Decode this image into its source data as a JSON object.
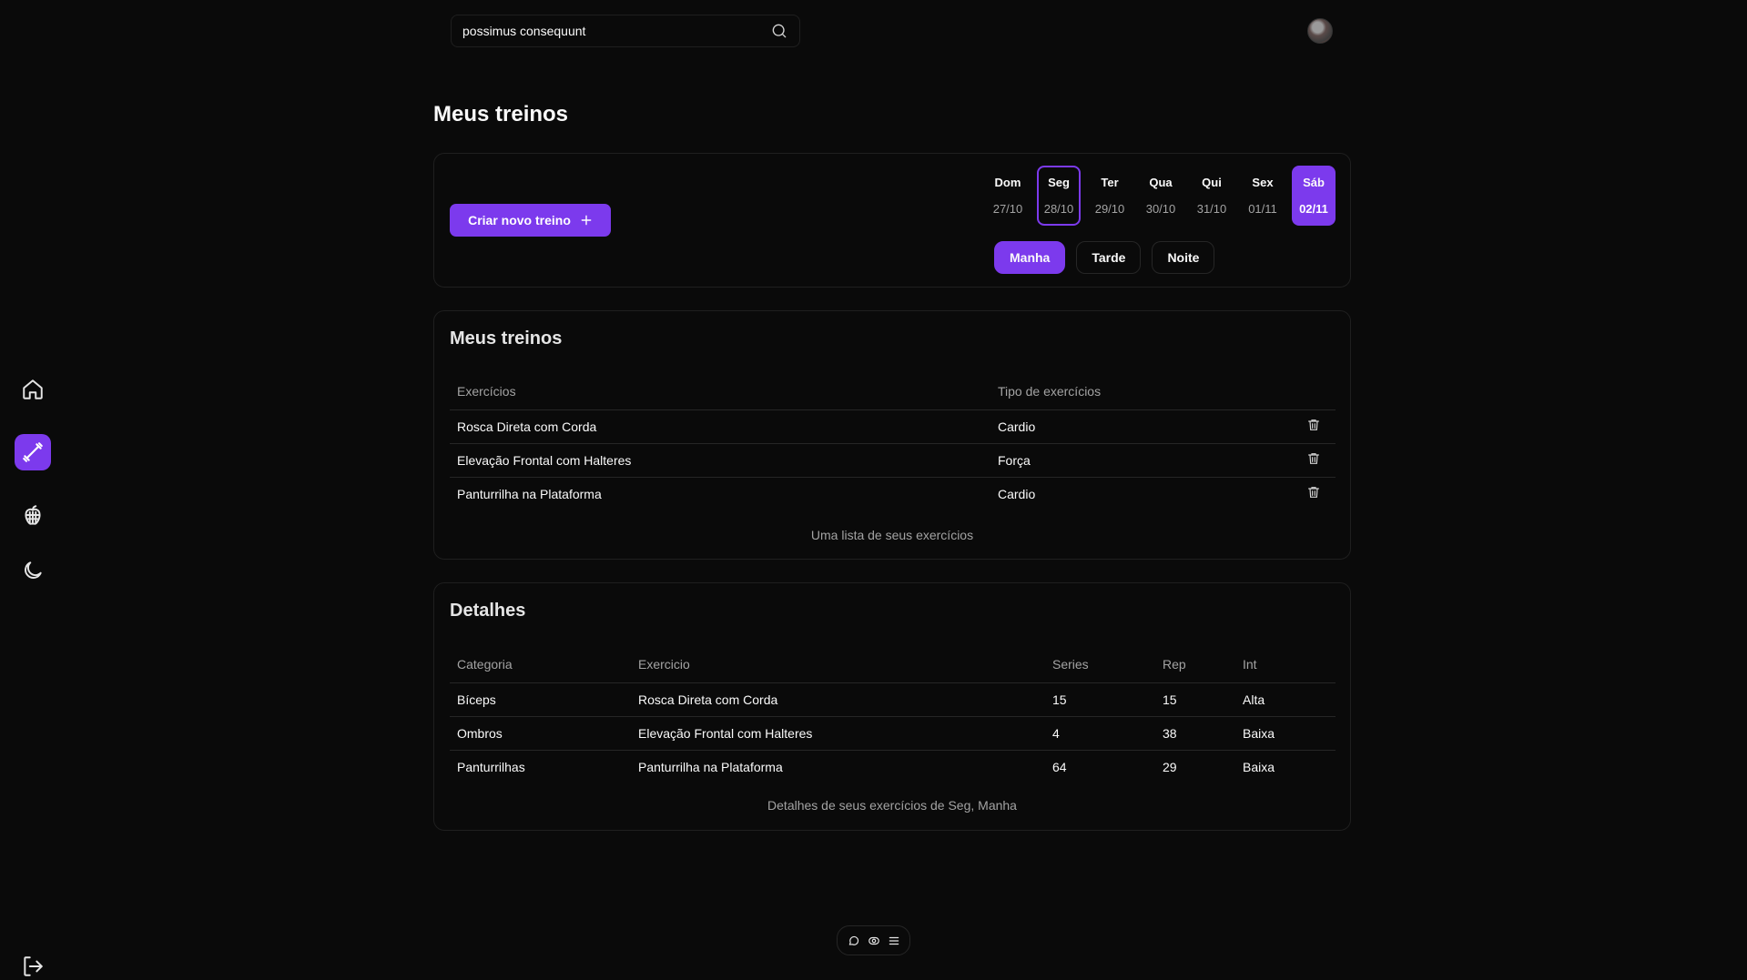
{
  "sidebar": {
    "items": [
      {
        "name": "home-icon",
        "active": false
      },
      {
        "name": "dumbbell-icon",
        "active": true
      },
      {
        "name": "apple-icon",
        "active": false
      },
      {
        "name": "moon-icon",
        "active": false
      }
    ],
    "logout_icon": "logout-icon"
  },
  "search": {
    "value": "possimus consequunt",
    "icon": "search-icon"
  },
  "page_title": "Meus treinos",
  "planner": {
    "create_label": "Criar novo treino",
    "create_icon": "plus-icon",
    "days": [
      {
        "name": "Dom",
        "date": "27/10",
        "state": "normal"
      },
      {
        "name": "Seg",
        "date": "28/10",
        "state": "outlined"
      },
      {
        "name": "Ter",
        "date": "29/10",
        "state": "normal"
      },
      {
        "name": "Qua",
        "date": "30/10",
        "state": "normal"
      },
      {
        "name": "Qui",
        "date": "31/10",
        "state": "normal"
      },
      {
        "name": "Sex",
        "date": "01/11",
        "state": "normal"
      },
      {
        "name": "Sáb",
        "date": "02/11",
        "state": "filled"
      }
    ],
    "shifts": [
      {
        "label": "Manha",
        "active": true
      },
      {
        "label": "Tarde",
        "active": false
      },
      {
        "label": "Noite",
        "active": false
      }
    ]
  },
  "workouts": {
    "title": "Meus treinos",
    "columns": [
      "Exercícios",
      "Tipo de exercícios"
    ],
    "rows": [
      {
        "exercise": "Rosca Direta com Corda",
        "type": "Cardio"
      },
      {
        "exercise": "Elevação Frontal com Halteres",
        "type": "Força"
      },
      {
        "exercise": "Panturrilha na Plataforma",
        "type": "Cardio"
      }
    ],
    "caption": "Uma lista de seus exercícios"
  },
  "details": {
    "title": "Detalhes",
    "columns": [
      "Categoria",
      "Exercicio",
      "Series",
      "Rep",
      "Int"
    ],
    "rows": [
      [
        "Bíceps",
        "Rosca Direta com Corda",
        "15",
        "15",
        "Alta"
      ],
      [
        "Ombros",
        "Elevação Frontal com Halteres",
        "4",
        "38",
        "Baixa"
      ],
      [
        "Panturrilhas",
        "Panturrilha na Plataforma",
        "64",
        "29",
        "Baixa"
      ]
    ],
    "caption": "Detalhes de seus exercícios de Seg, Manha"
  },
  "colors": {
    "accent": "#7c3aed",
    "background": "#0a0a0a",
    "border": "#1f1f1f"
  }
}
